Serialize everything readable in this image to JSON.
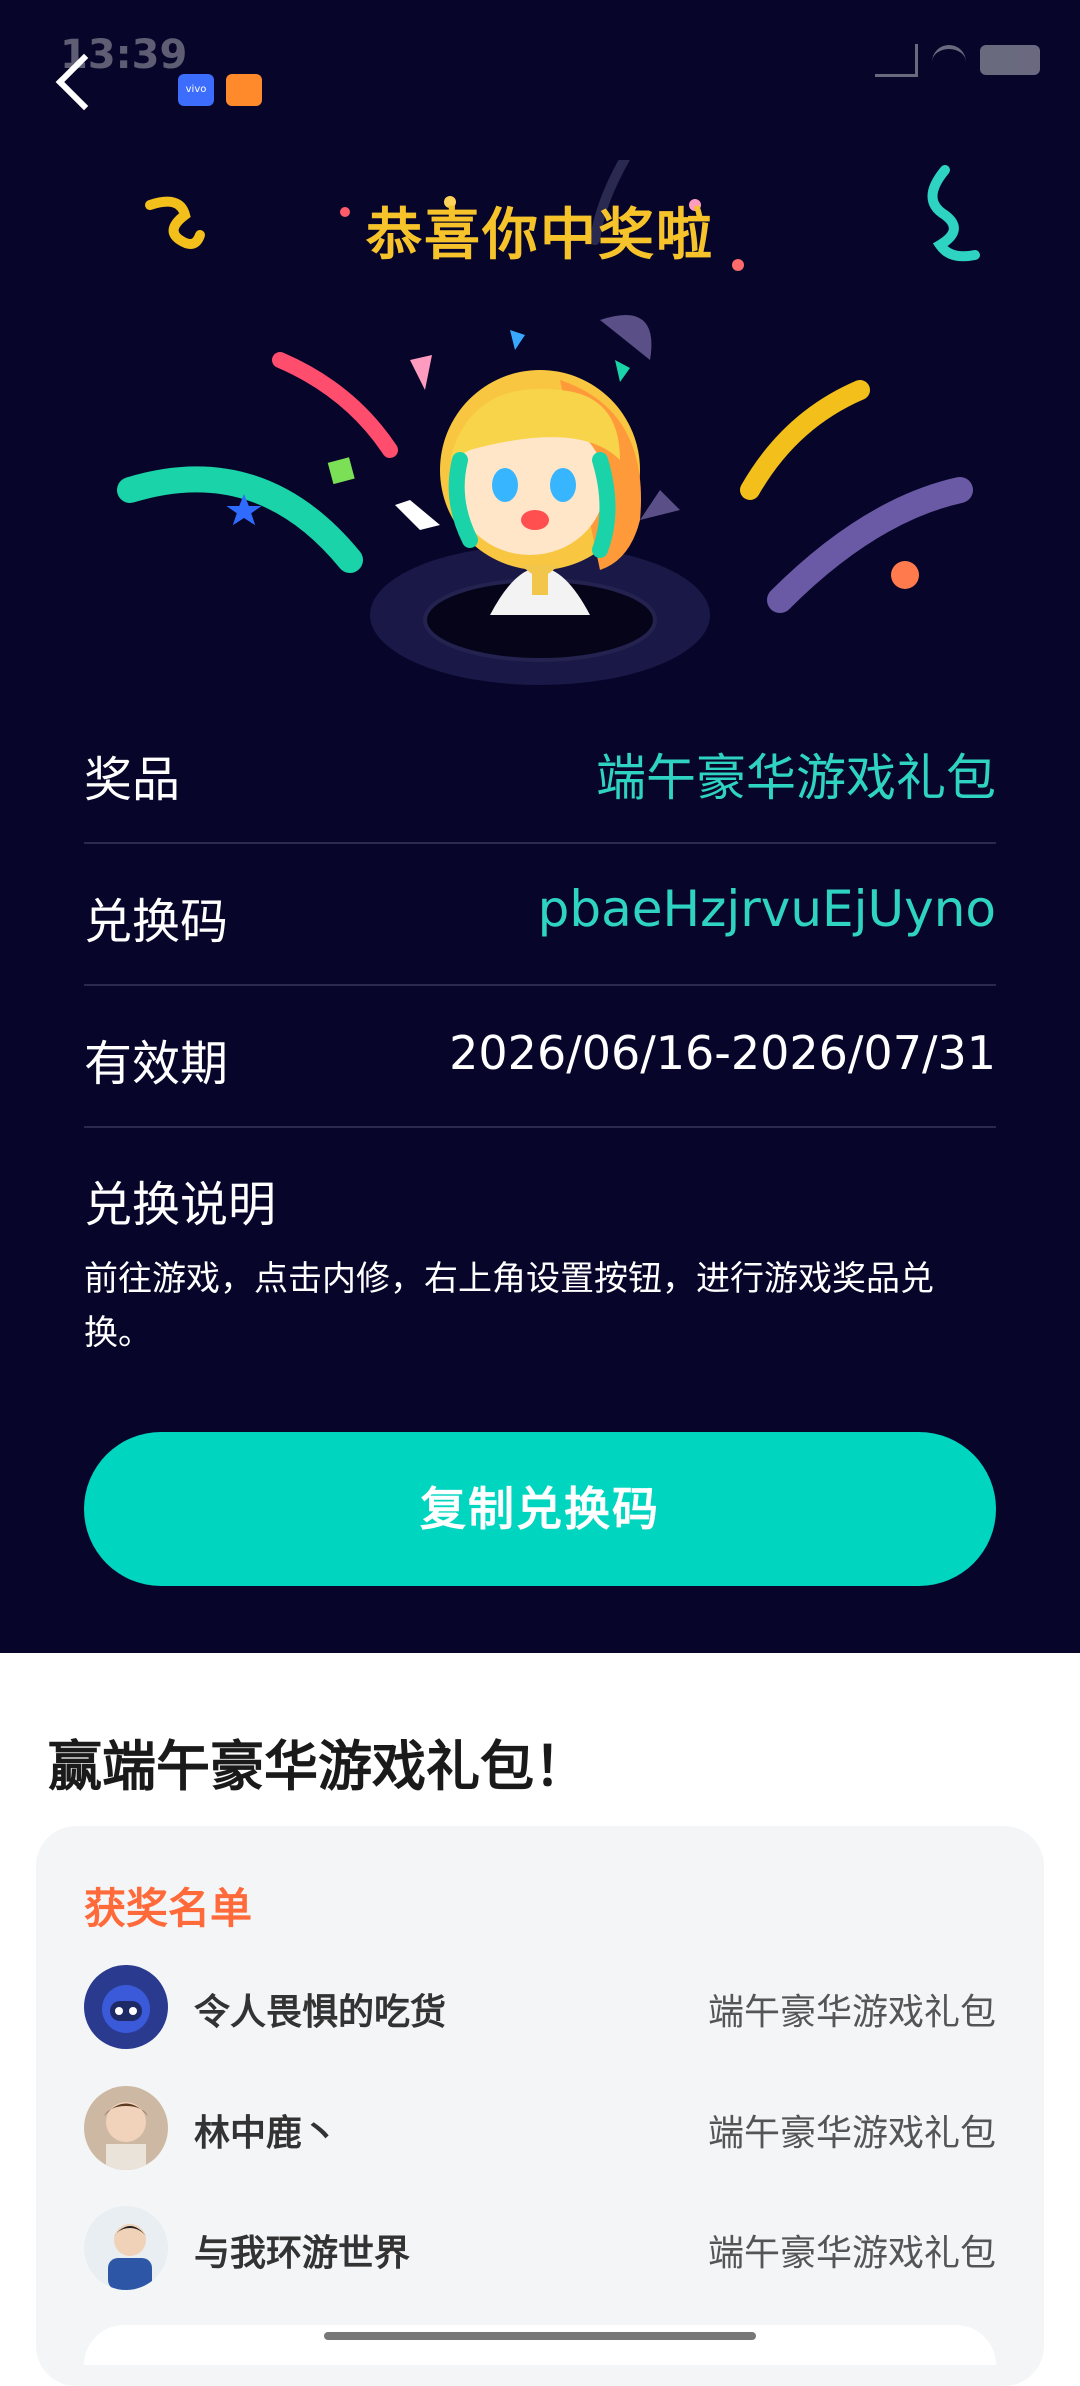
{
  "status_bar": {
    "time": "13:39",
    "app1": "vivo"
  },
  "header": {
    "title": "恭喜你中奖啦"
  },
  "prize_info": [
    {
      "label": "奖品",
      "value": "端午豪华游戏礼包"
    },
    {
      "label": "兑换码",
      "value": "pbaeHzjrvuEjUyno"
    },
    {
      "label": "有效期",
      "value": "2026/06/16-2026/07/31"
    }
  ],
  "instructions": {
    "title": "兑换说明",
    "text": "前往游戏，点击内修，右上角设置按钮，进行游戏奖品兑换。"
  },
  "copy_button": {
    "label": "复制兑换码"
  },
  "bottom": {
    "title": "赢端午豪华游戏礼包！",
    "list_title": "获奖名单",
    "winners": [
      {
        "name": "令人畏惧的吃货",
        "prize": "端午豪华游戏礼包"
      },
      {
        "name": "林中鹿丶",
        "prize": "端午豪华游戏礼包"
      },
      {
        "name": "与我环游世界",
        "prize": "端午豪华游戏礼包"
      }
    ]
  },
  "colors": {
    "background": "#07062a",
    "accent": "#00d5c0",
    "title": "#f7c32b",
    "list_title": "#ff6a3b"
  }
}
